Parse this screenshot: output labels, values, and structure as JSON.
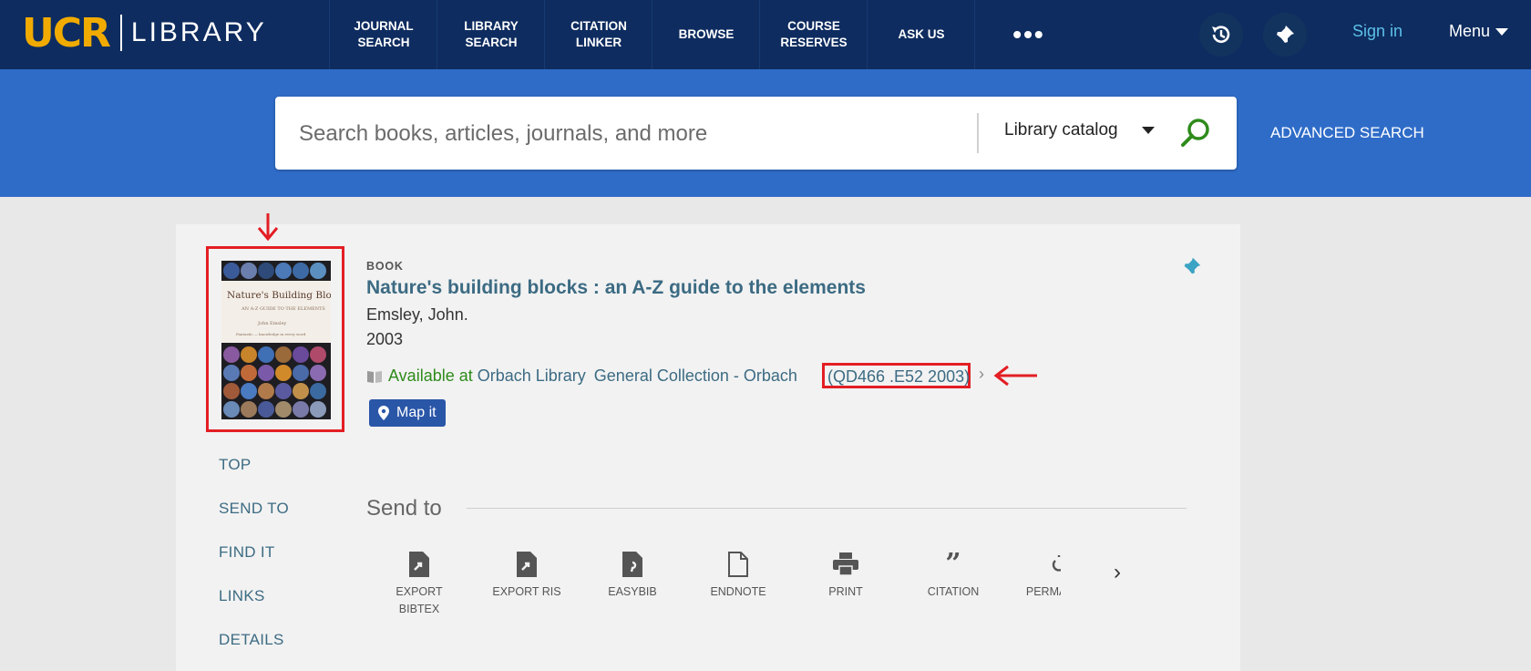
{
  "header": {
    "logo_primary": "UCR",
    "logo_secondary": "LIBRARY",
    "nav": [
      "JOURNAL SEARCH",
      "LIBRARY SEARCH",
      "CITATION LINKER",
      "BROWSE",
      "COURSE RESERVES",
      "ASK US"
    ],
    "more": "•••",
    "sign_in": "Sign in",
    "menu": "Menu"
  },
  "search": {
    "placeholder": "Search books, articles, journals, and more",
    "scope": "Library catalog",
    "advanced": "ADVANCED SEARCH"
  },
  "record": {
    "type": "BOOK",
    "title": "Nature's building blocks : an A-Z guide to the elements",
    "author": "Emsley, John.",
    "year": "2003",
    "availability": "Available at",
    "library": "Orbach Library",
    "collection": "General Collection - Orbach",
    "call_number": "(QD466 .E52 2003)",
    "map_it": "Map it",
    "cover": {
      "title": "Nature's Building Blocks",
      "subtitle": "AN A-Z GUIDE TO THE ELEMENTS",
      "author": "John Emsley",
      "note": "Fantastic — knowledge in every word"
    }
  },
  "side_nav": [
    "TOP",
    "SEND TO",
    "FIND IT",
    "LINKS",
    "DETAILS"
  ],
  "send_to": {
    "heading": "Send to",
    "actions": [
      "EXPORT BIBTEX",
      "EXPORT RIS",
      "EASYBIB",
      "ENDNOTE",
      "PRINT",
      "CITATION",
      "PERMALINK"
    ]
  },
  "colors": {
    "header_bg": "#0e2c5f",
    "search_band": "#2f6cc8",
    "link": "#3c6b83",
    "available": "#2e8b1b",
    "highlight": "#e31e24"
  }
}
